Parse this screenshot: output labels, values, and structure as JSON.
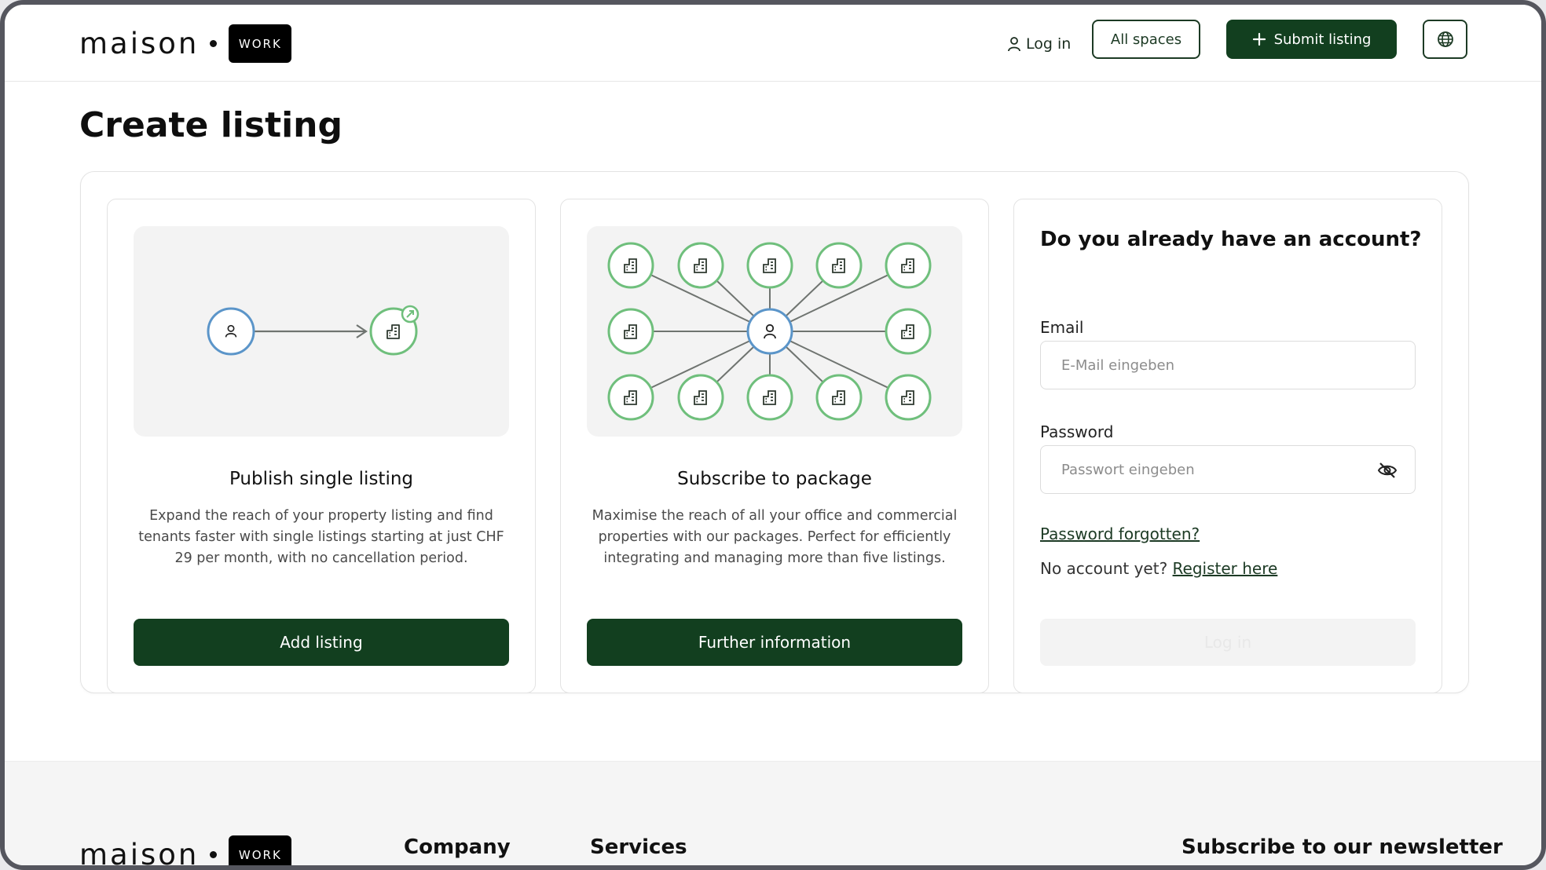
{
  "brand": {
    "name": "maison",
    "badge": "WORK"
  },
  "nav": {
    "login": "Log in",
    "all_spaces": "All spaces",
    "submit_listing": "Submit listing"
  },
  "page": {
    "title": "Create listing"
  },
  "cards": {
    "single": {
      "title": "Publish single listing",
      "description": "Expand the reach of your property listing and find tenants faster with single listings starting at just CHF 29 per month, with no cancellation period.",
      "button": "Add listing"
    },
    "package": {
      "title": "Subscribe to package",
      "description": "Maximise the reach of all your office and commercial properties with our packages. Perfect for efficiently integrating and managing more than five listings.",
      "button": "Further information"
    }
  },
  "login": {
    "title": "Do you already have an account?",
    "email_label": "Email",
    "email_placeholder": "E-Mail eingeben",
    "password_label": "Password",
    "password_placeholder": "Passwort eingeben",
    "forgot": "Password forgotten?",
    "no_account": "No account yet?",
    "register": "Register here",
    "button": "Log in"
  },
  "footer": {
    "company": "Company",
    "services": "Services",
    "newsletter": "Subscribe to our newsletter"
  },
  "colors": {
    "primary": "#123f1f",
    "node_green": "#6fbf7c",
    "node_blue": "#5b95c9"
  }
}
